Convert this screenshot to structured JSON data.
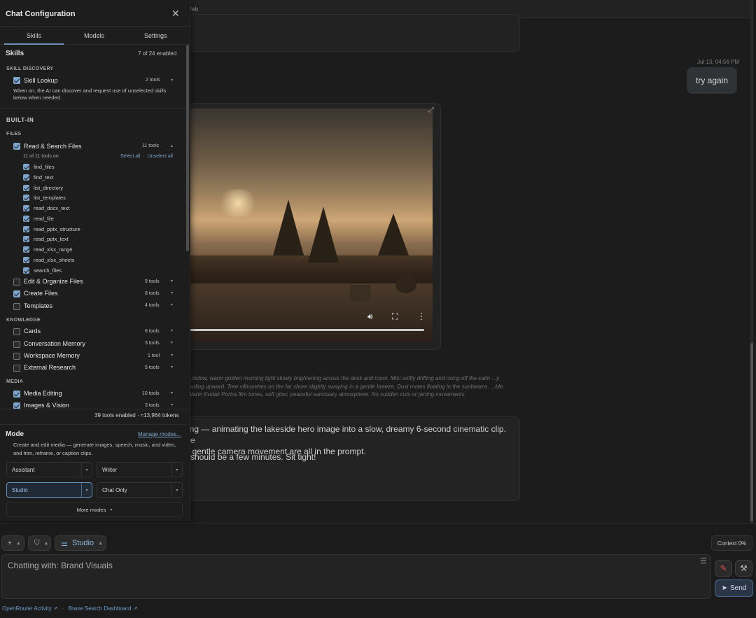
{
  "chat": {
    "topbar_label": "Web",
    "timestamp": "Jul 13, 04:56 PM",
    "user_message": "try again",
    "video_controls": {
      "volume_icon": "volume-icon",
      "fullscreen_icon": "fullscreen-icon",
      "more_icon": "more-icon"
    },
    "prompt_text": "...indow, warm golden morning light slowly brightening across the desk and room. Mist softly drifting and rising off the calm ...y curling upward. Tree silhouettes on the far shore slightly swaying in a gentle breeze. Dust motes floating in the sunbeams. ...ble. Warm Kodak Portra film tones, soft glow, peaceful sanctuary atmosphere. No sudden cuts or jarring movements.",
    "assistant_line1": "ating — animating the lakeside hero image into a slow, dreamy 6-second cinematic clip. The",
    "assistant_line2": "nd gentle camera movement are all in the prompt.",
    "assistant_line3": "should be a few minutes. Sit tight!"
  },
  "composer": {
    "plus_label": "+",
    "shield_label": "⛉",
    "mode_label": "Studio",
    "context_label": "Context 0%",
    "placeholder": "Chatting with: Brand Visuals",
    "send_label": "Send",
    "footer_links": [
      "OpenRouter Activity ↗",
      "Brave Search Dashboard ↗"
    ]
  },
  "panel": {
    "title": "Chat Configuration",
    "tabs": [
      "Skills",
      "Models",
      "Settings"
    ],
    "section_title": "Skills",
    "enabled_count": "7 of 24 enabled",
    "skill_discovery_label": "SKILL DISCOVERY",
    "skill_lookup": {
      "name": "Skill Lookup",
      "count": "2 tools",
      "desc": "When on, the AI can discover and request use of unselected skills below when needed."
    },
    "builtin_label": "BUILT-IN",
    "files_label": "FILES",
    "read_search": {
      "name": "Read & Search Files",
      "count": "11 tools",
      "tools_on": "11 of 11 tools on",
      "select_all": "Select all",
      "unselect_all": "Unselect all"
    },
    "tools": [
      "find_files",
      "find_text",
      "list_directory",
      "list_templates",
      "read_docx_text",
      "read_file",
      "read_pptx_structure",
      "read_pptx_text",
      "read_xlsx_range",
      "read_xlsx_sheets",
      "search_files"
    ],
    "files_skills": [
      {
        "name": "Edit & Organize Files",
        "count": "9 tools"
      },
      {
        "name": "Create Files",
        "count": "8 tools"
      },
      {
        "name": "Templates",
        "count": "4 tools"
      }
    ],
    "knowledge_label": "KNOWLEDGE",
    "knowledge_skills": [
      {
        "name": "Cards",
        "count": "6 tools"
      },
      {
        "name": "Conversation Memory",
        "count": "3 tools"
      },
      {
        "name": "Workspace Memory",
        "count": "1 tool"
      },
      {
        "name": "External Research",
        "count": "5 tools"
      }
    ],
    "media_label": "MEDIA",
    "media_skills": [
      {
        "name": "Media Editing",
        "count": "10 tools"
      },
      {
        "name": "Images & Vision",
        "count": "3 tools"
      }
    ],
    "summary": "39 tools enabled · ≈13,964 tokens",
    "mode_title": "Mode",
    "manage_modes": "Manage modes...",
    "mode_desc": "Create and edit media — generate images, speech, music, and video, and trim, reframe, or caption clips.",
    "modes": [
      "Assistant",
      "Writer",
      "Studio",
      "Chat Only"
    ],
    "more_modes": "More modes"
  }
}
